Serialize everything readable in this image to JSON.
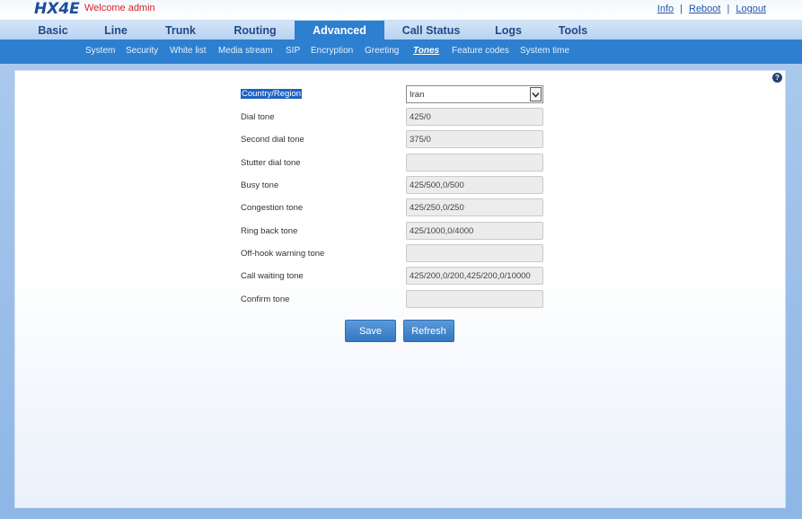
{
  "header": {
    "logo": "HX4E",
    "welcome": "Welcome admin",
    "links": [
      "Info",
      "Reboot",
      "Logout"
    ]
  },
  "main_nav": [
    "Basic",
    "Line",
    "Trunk",
    "Routing",
    "Advanced",
    "Call Status",
    "Logs",
    "Tools"
  ],
  "main_nav_active": "Advanced",
  "sub_nav": [
    "System",
    "Security",
    "White list",
    "Media stream",
    "SIP",
    "Encryption",
    "Greeting",
    "Tones",
    "Feature codes",
    "System time"
  ],
  "sub_nav_active": "Tones",
  "form": {
    "country_label": "Country/Region",
    "country_value": "Iran",
    "rows": [
      {
        "label": "Dial tone",
        "value": "425/0"
      },
      {
        "label": "Second dial tone",
        "value": "375/0"
      },
      {
        "label": "Stutter dial tone",
        "value": ""
      },
      {
        "label": "Busy tone",
        "value": "425/500,0/500"
      },
      {
        "label": "Congestion tone",
        "value": "425/250,0/250"
      },
      {
        "label": "Ring back tone",
        "value": "425/1000,0/4000"
      },
      {
        "label": "Off-hook warning tone",
        "value": ""
      },
      {
        "label": "Call waiting tone",
        "value": "425/200,0/200,425/200,0/10000"
      },
      {
        "label": "Confirm tone",
        "value": ""
      }
    ]
  },
  "buttons": {
    "save": "Save",
    "refresh": "Refresh"
  },
  "colors": {
    "accent": "#2d7fd0",
    "brand": "#1b4f9c",
    "welcome": "#d9232a"
  },
  "icons": {
    "help": "help-icon",
    "dropdown": "chevron-down-icon"
  }
}
